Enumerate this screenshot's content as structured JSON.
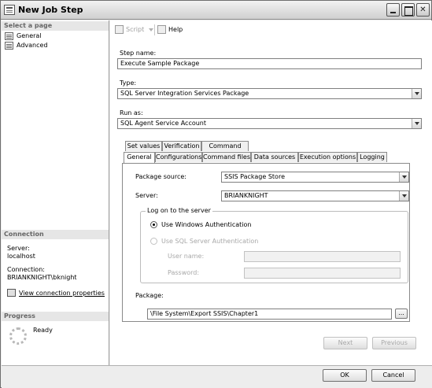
{
  "window": {
    "title": "New Job Step"
  },
  "left": {
    "select_page_header": "Select a page",
    "pages": [
      {
        "label": "General"
      },
      {
        "label": "Advanced"
      }
    ],
    "connection_header": "Connection",
    "server_label": "Server:",
    "server_value": "localhost",
    "connection_label": "Connection:",
    "connection_value": "BRIANKNIGHT\\bknight",
    "view_props_link": "View connection properties",
    "progress_header": "Progress",
    "progress_status": "Ready"
  },
  "toolbar": {
    "script_label": "Script",
    "help_label": "Help"
  },
  "form": {
    "step_name_label": "Step name:",
    "step_name_value": "Execute Sample Package",
    "type_label": "Type:",
    "type_value": "SQL Server Integration Services Package",
    "run_as_label": "Run as:",
    "run_as_value": "SQL Agent Service Account"
  },
  "tabs_row1": [
    "Set values",
    "Verification",
    "Command line"
  ],
  "tabs_row2": [
    "General",
    "Configurations",
    "Command files",
    "Data sources",
    "Execution options",
    "Logging"
  ],
  "general_tab": {
    "package_source_label": "Package source:",
    "package_source_value": "SSIS Package Store",
    "server_label": "Server:",
    "server_value": "BRIANKNIGHT",
    "logon_group_title": "Log on to the server",
    "windows_auth_label": "Use Windows Authentication",
    "sql_auth_label": "Use SQL Server Authentication",
    "user_name_label": "User name:",
    "password_label": "Password:",
    "package_label": "Package:",
    "package_value": "\\File System\\Export SSIS\\Chapter1",
    "browse_label": "..."
  },
  "nav": {
    "next_label": "Next",
    "previous_label": "Previous"
  },
  "footer": {
    "ok_label": "OK",
    "cancel_label": "Cancel"
  }
}
